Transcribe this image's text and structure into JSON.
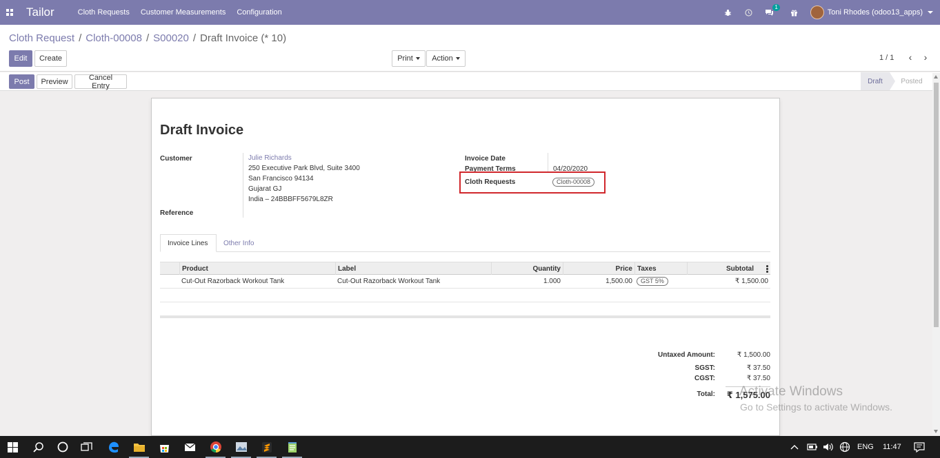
{
  "navbar": {
    "brand": "Tailor",
    "menu": [
      "Cloth Requests",
      "Customer Measurements",
      "Configuration"
    ],
    "chat_badge": "1",
    "user_name": "Toni Rhodes (odoo13_apps)",
    "accent": "#7c7bad"
  },
  "breadcrumb": {
    "items": [
      "Cloth Request",
      "Cloth-00008",
      "S00020"
    ],
    "current": "Draft Invoice (* 10)"
  },
  "toolbar": {
    "edit": "Edit",
    "create": "Create",
    "print": "Print",
    "action": "Action",
    "pager": "1 / 1"
  },
  "statusbar": {
    "post": "Post",
    "preview": "Preview",
    "cancel_entry": "Cancel Entry",
    "stages": [
      "Draft",
      "Posted"
    ]
  },
  "invoice": {
    "title": "Draft Invoice",
    "customer_label": "Customer",
    "customer_name": "Julie Richards",
    "address": [
      "250 Executive Park Blvd, Suite 3400",
      "San Francisco 94134",
      "Gujarat GJ",
      "India – 24BBBFF5679L8ZR"
    ],
    "reference_label": "Reference",
    "invoice_date_label": "Invoice Date",
    "payment_terms_label": "Payment Terms",
    "payment_terms_value": "04/20/2020",
    "cloth_requests_label": "Cloth Requests",
    "cloth_requests_tag": "Cloth-00008",
    "highlight_color": "#d0262b"
  },
  "tabs": [
    "Invoice Lines",
    "Other Info"
  ],
  "lines": {
    "headers": [
      "Product",
      "Label",
      "Quantity",
      "Price",
      "Taxes",
      "Subtotal"
    ],
    "rows": [
      {
        "product": "Cut-Out Razorback Workout Tank",
        "label": "Cut-Out Razorback Workout Tank",
        "quantity": "1.000",
        "price": "1,500.00",
        "taxes": "GST 5%",
        "subtotal": "₹ 1,500.00"
      }
    ]
  },
  "totals": {
    "untaxed_label": "Untaxed Amount:",
    "untaxed_value": "₹ 1,500.00",
    "sgst_label": "SGST:",
    "sgst_value": "₹ 37.50",
    "cgst_label": "CGST:",
    "cgst_value": "₹ 37.50",
    "total_label": "Total:",
    "total_value": "₹ 1,575.00"
  },
  "watermark": {
    "line1": "Activate Windows",
    "line2": "Go to Settings to activate Windows."
  },
  "taskbar": {
    "icons": [
      "windows-start-icon",
      "search-icon",
      "cortana-icon",
      "task-view-icon",
      "edge-icon",
      "file-explorer-icon",
      "store-icon",
      "mail-icon",
      "chrome-icon",
      "photos-icon",
      "sublime-icon",
      "notepad-icon"
    ],
    "language": "ENG",
    "time": "11:47"
  }
}
